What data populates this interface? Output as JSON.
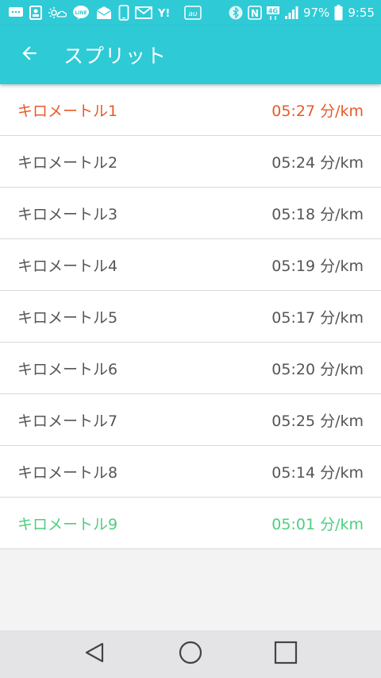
{
  "status_bar": {
    "battery": "97%",
    "time": "9:55",
    "network": "4G",
    "icons_left": [
      "message-icon",
      "contacts-icon",
      "weather-icon",
      "line-icon",
      "mail-box-icon",
      "phone-icon",
      "mail-icon",
      "yahoo-icon",
      "au-icon"
    ],
    "icons_right": [
      "bluetooth-icon",
      "nfc-icon",
      "network-icon",
      "signal-icon",
      "battery-icon"
    ]
  },
  "app_bar": {
    "title": "スプリット",
    "back_icon": "arrow-left-icon"
  },
  "colors": {
    "primary": "#2ecad6",
    "slowest": "#e85a2a",
    "fastest": "#4ccf7f",
    "normal": "#555555"
  },
  "splits": [
    {
      "label": "キロメートル1",
      "pace": "05:27 分/km",
      "status": "slowest"
    },
    {
      "label": "キロメートル2",
      "pace": "05:24 分/km",
      "status": "normal"
    },
    {
      "label": "キロメートル3",
      "pace": "05:18 分/km",
      "status": "normal"
    },
    {
      "label": "キロメートル4",
      "pace": "05:19 分/km",
      "status": "normal"
    },
    {
      "label": "キロメートル5",
      "pace": "05:17 分/km",
      "status": "normal"
    },
    {
      "label": "キロメートル6",
      "pace": "05:20 分/km",
      "status": "normal"
    },
    {
      "label": "キロメートル7",
      "pace": "05:25 分/km",
      "status": "normal"
    },
    {
      "label": "キロメートル8",
      "pace": "05:14 分/km",
      "status": "normal"
    },
    {
      "label": "キロメートル9",
      "pace": "05:01 分/km",
      "status": "fastest"
    }
  ],
  "nav_bar": {
    "buttons": [
      "back-triangle-icon",
      "home-circle-icon",
      "recents-square-icon"
    ]
  }
}
